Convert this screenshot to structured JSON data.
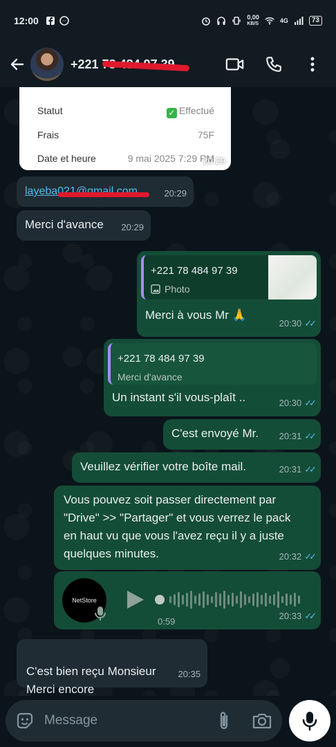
{
  "status_bar": {
    "time": "12:00",
    "network_speed": "0,00",
    "network_unit": "KB/S",
    "signal_label": "4G",
    "battery": "73"
  },
  "header": {
    "contact_name": "+221 78 484 97 39",
    "icons": [
      "back-arrow-icon",
      "video-call-icon",
      "phone-icon",
      "more-vert-icon"
    ]
  },
  "receipt": {
    "rows": [
      {
        "label": "Statut",
        "value": "Effectué"
      },
      {
        "label": "Frais",
        "value": "75F"
      },
      {
        "label": "Date et heure",
        "value": "9 mai 2025 7:29 PM"
      }
    ],
    "time": "20:29"
  },
  "messages": [
    {
      "id": "m1",
      "dir": "in",
      "text": "layeba021@gmail.com",
      "time": "20:29"
    },
    {
      "id": "m2",
      "dir": "in",
      "text": "Merci d'avance",
      "time": "20:29"
    },
    {
      "id": "m3",
      "dir": "out",
      "quote_name": "+221 78 484 97 39",
      "quote_text": "Photo",
      "text": "Merci à vous Mr 🙏",
      "time": "20:30"
    },
    {
      "id": "m4",
      "dir": "out",
      "quote_name": "+221 78 484 97 39",
      "quote_text": "Merci d'avance",
      "text": "Un instant s'il vous-plaît ..",
      "time": "20:30"
    },
    {
      "id": "m5",
      "dir": "out",
      "text": "C'est envoyé Mr.",
      "time": "20:31"
    },
    {
      "id": "m6",
      "dir": "out",
      "text": "Veuillez vérifier votre boîte mail.",
      "time": "20:31"
    },
    {
      "id": "m7",
      "dir": "out",
      "text": "Vous pouvez soit passer directement par \"Drive\" >> \"Partager\" et vous verrez le pack en haut vu que vous l'avez reçu il y a juste quelques minutes.",
      "time": "20:32"
    },
    {
      "id": "m8",
      "dir": "out",
      "type": "voice",
      "avatar_label": "NetStore",
      "duration": "0:59",
      "time": "20:33"
    },
    {
      "id": "m9",
      "dir": "in",
      "text": "C'est bien reçu Monsieur\nMerci encore",
      "time": "20:35"
    }
  ],
  "input": {
    "placeholder": "Message"
  },
  "colors": {
    "incoming_bubble": "#1f2c34",
    "outgoing_bubble": "#144d37",
    "read_ticks": "#53bdeb",
    "redaction": "#e0192c"
  }
}
